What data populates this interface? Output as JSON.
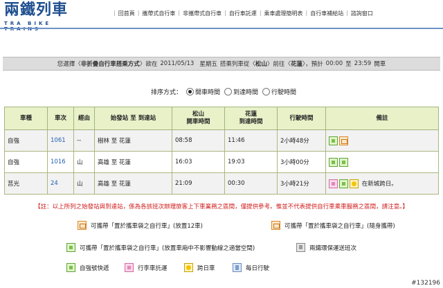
{
  "logo": {
    "title": "兩鐵列車",
    "subtitle": "TRA BIKE TRAINS"
  },
  "nav": [
    "回首頁",
    "攜帶式自行車",
    "非攜帶式自行車",
    "自行車託運",
    "乘車處理簡明表",
    "自行車補給站",
    "諮詢窗口"
  ],
  "query": {
    "prefix": "您選擇〈",
    "mode": "非折疊自行車搭乘方式",
    "mid1": "〉欲在",
    "date": "2011/05/13",
    "weekday": "星期五",
    "mid2": "搭乘列車從〈",
    "from": "松山",
    "mid3": "〉前往〈",
    "to": "花蓮",
    "mid4": "〉，預計",
    "time_from": "00:00",
    "mid5": "至",
    "time_to": "23:59",
    "suffix": "開車"
  },
  "sort": {
    "label": "排序方式：",
    "options": [
      {
        "label": "開車時間",
        "selected": true
      },
      {
        "label": "到達時間",
        "selected": false
      },
      {
        "label": "行駛時間",
        "selected": false
      }
    ]
  },
  "table": {
    "headers": {
      "type": "車種",
      "no": "車次",
      "via": "經由",
      "route": "始發站 至 到達站",
      "dep1": "松山",
      "dep2": "開車時間",
      "arr1": "花蓮",
      "arr2": "到達時間",
      "dur": "行駛時間",
      "remark": "備註"
    },
    "rows": [
      {
        "type": "自強",
        "no": "1061",
        "via": "--",
        "route": "樹林 至 花蓮",
        "dep": "08:58",
        "arr": "11:46",
        "dur": "2小時48分",
        "icons": [
          "green",
          "orange"
        ],
        "remark": ""
      },
      {
        "type": "自強",
        "no": "1016",
        "via": "山",
        "route": "高雄 至 花蓮",
        "dep": "16:03",
        "arr": "19:03",
        "dur": "3小時00分",
        "icons": [
          "green",
          "green"
        ],
        "remark": ""
      },
      {
        "type": "莒光",
        "no": "24",
        "via": "山",
        "route": "高雄 至 花蓮",
        "dep": "21:09",
        "arr": "00:30",
        "dur": "3小時21分",
        "icons": [
          "pink",
          "green",
          "yellow"
        ],
        "remark": "在新城跨日。"
      }
    ]
  },
  "note": "【註：以上所列之始發站與到達站，係為各該班次辦理旅客上下車業務之區間，僅提供參考。惟並不代表提供自行車乘車服務之區間，請注意。】",
  "legend": [
    {
      "icon": "orange",
      "icon_name": "bike-bagged-12-icon",
      "text": "可攜帶「置於攜車袋之自行車」(放置12車)"
    },
    {
      "icon": "orange",
      "icon_name": "bike-bagged-carry-icon",
      "text": "可攜帶「置於攜車袋之自行車」(隨身攜帶)"
    },
    {
      "icon": "green",
      "icon_name": "bike-bagged-space-icon",
      "text": "可攜帶「置於攜車袋之自行車」(放置車廂中不影響動線之適當空間)"
    },
    {
      "icon": "grey",
      "icon_name": "two-rail-ring-icon",
      "text": "兩鐵環保運送班次"
    },
    {
      "icon": "green",
      "icon_name": "tze-chiang-express-icon",
      "text": "自強號快遞"
    },
    {
      "icon": "pink",
      "icon_name": "luggage-consign-icon",
      "text": "行李車託運"
    },
    {
      "icon": "yellow",
      "icon_name": "cross-day-icon",
      "text": "跨日車"
    },
    {
      "icon": "blue",
      "icon_name": "daily-service-icon",
      "text": "每日行駛"
    }
  ],
  "watermark": "#132196"
}
